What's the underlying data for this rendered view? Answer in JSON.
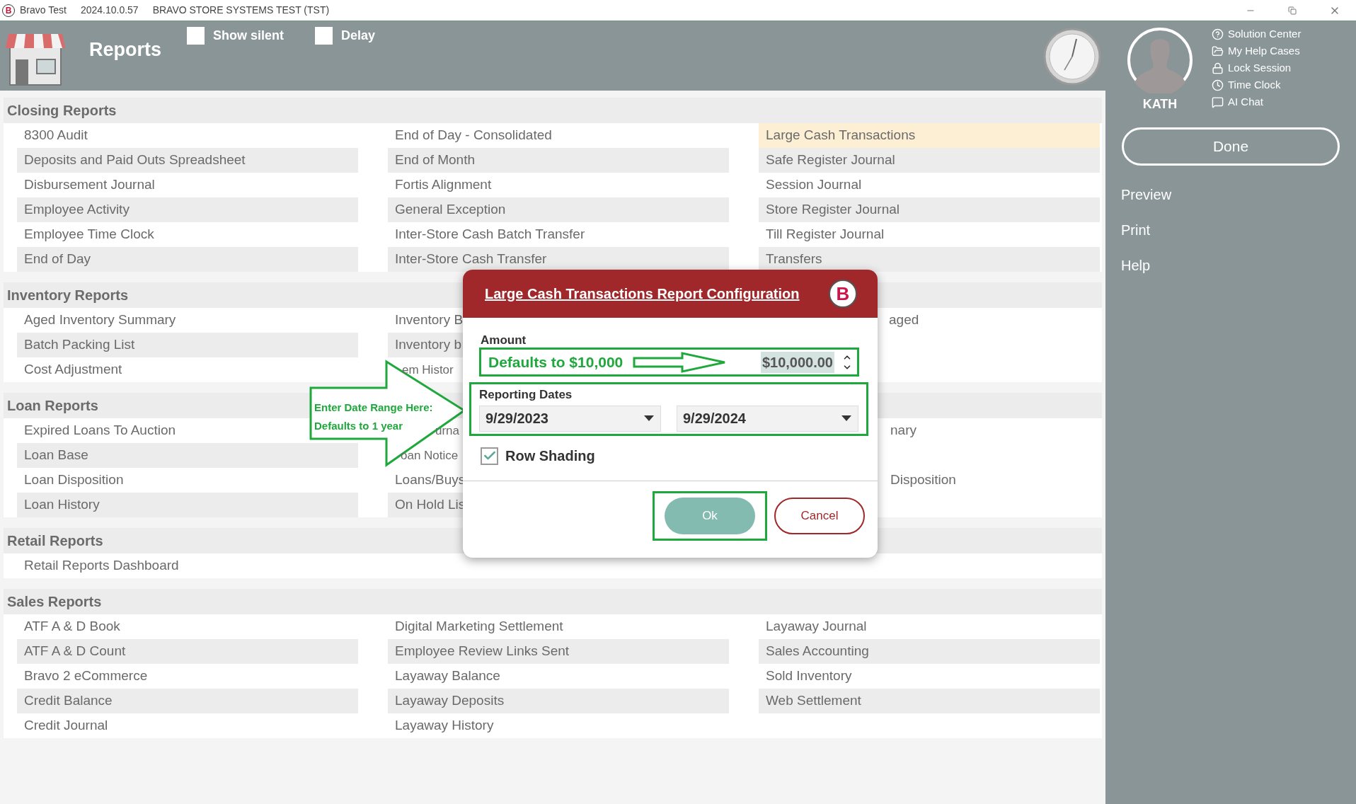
{
  "window": {
    "logo": "B",
    "title": "Bravo Test",
    "version": "2024.10.0.57",
    "environment": "BRAVO STORE SYSTEMS TEST (TST)"
  },
  "header": {
    "title": "Reports",
    "options": [
      {
        "label": "Show silent",
        "checked": false
      },
      {
        "label": "Delay",
        "checked": false
      }
    ]
  },
  "sections": [
    {
      "title": "Closing Reports",
      "rows": [
        [
          {
            "label": "8300 Audit",
            "selected": false
          },
          {
            "label": "End of Day - Consolidated",
            "selected": false
          },
          {
            "label": "Large Cash Transactions",
            "selected": true
          }
        ],
        [
          {
            "label": "Deposits and Paid Outs Spreadsheet",
            "selected": false
          },
          {
            "label": "End of Month",
            "selected": false
          },
          {
            "label": "Safe Register Journal",
            "selected": false
          }
        ],
        [
          {
            "label": "Disbursement Journal",
            "selected": false
          },
          {
            "label": "Fortis Alignment",
            "selected": false
          },
          {
            "label": "Session Journal",
            "selected": false
          }
        ],
        [
          {
            "label": "Employee Activity",
            "selected": false
          },
          {
            "label": "General Exception",
            "selected": false
          },
          {
            "label": "Store Register Journal",
            "selected": false
          }
        ],
        [
          {
            "label": "Employee Time Clock",
            "selected": false
          },
          {
            "label": "Inter-Store Cash Batch Transfer",
            "selected": false
          },
          {
            "label": "Till Register Journal",
            "selected": false
          }
        ],
        [
          {
            "label": "End of Day",
            "selected": false
          },
          {
            "label": "Inter-Store Cash Transfer",
            "selected": false
          },
          {
            "label": "Transfers",
            "selected": false
          }
        ]
      ]
    },
    {
      "title": "Inventory Reports",
      "rows": [
        [
          {
            "label": "Aged Inventory Summary",
            "selected": false
          },
          {
            "label": "Inventory B",
            "selected": false
          },
          {
            "label": "aged",
            "selected": false
          }
        ],
        [
          {
            "label": "Batch Packing List",
            "selected": false
          },
          {
            "label": "Inventory b",
            "selected": false
          },
          null
        ],
        [
          {
            "label": "Cost Adjustment",
            "selected": false
          },
          {
            "label": "em Histor",
            "selected": false
          },
          null
        ]
      ]
    },
    {
      "title": "Loan Reports",
      "rows": [
        [
          {
            "label": "Expired Loans To Auction",
            "selected": false
          },
          {
            "label": "urna",
            "selected": false
          },
          {
            "label": "nary",
            "selected": false
          }
        ],
        [
          {
            "label": "Loan Base",
            "selected": false
          },
          {
            "label": "oan Notice",
            "selected": false
          },
          null
        ],
        [
          {
            "label": "Loan Disposition",
            "selected": false
          },
          {
            "label": "Loans/Buys",
            "selected": false
          },
          {
            "label": "Disposition",
            "selected": false
          }
        ],
        [
          {
            "label": "Loan History",
            "selected": false
          },
          {
            "label": "On Hold Lis",
            "selected": false
          },
          null
        ]
      ]
    },
    {
      "title": "Retail Reports",
      "rows": [
        [
          {
            "label": "Retail Reports Dashboard",
            "selected": false
          },
          null,
          null
        ]
      ]
    },
    {
      "title": "Sales Reports",
      "rows": [
        [
          {
            "label": "ATF A & D Book",
            "selected": false
          },
          {
            "label": "Digital Marketing Settlement",
            "selected": false
          },
          {
            "label": "Layaway Journal",
            "selected": false
          }
        ],
        [
          {
            "label": "ATF A & D Count",
            "selected": false
          },
          {
            "label": "Employee Review Links Sent",
            "selected": false
          },
          {
            "label": "Sales Accounting",
            "selected": false
          }
        ],
        [
          {
            "label": "Bravo 2 eCommerce",
            "selected": false
          },
          {
            "label": "Layaway Balance",
            "selected": false
          },
          {
            "label": "Sold Inventory",
            "selected": false
          }
        ],
        [
          {
            "label": "Credit Balance",
            "selected": false
          },
          {
            "label": "Layaway Deposits",
            "selected": false
          },
          {
            "label": "Web Settlement",
            "selected": false
          }
        ],
        [
          {
            "label": "Credit Journal",
            "selected": false
          },
          {
            "label": "Layaway History",
            "selected": false
          },
          null
        ]
      ]
    }
  ],
  "user": {
    "name": "KATH"
  },
  "user_menu": [
    {
      "kind": "help",
      "label": "Solution Center"
    },
    {
      "kind": "folder",
      "label": "My Help Cases"
    },
    {
      "kind": "lock",
      "label": "Lock Session"
    },
    {
      "kind": "clock",
      "label": "Time Clock"
    },
    {
      "kind": "chat",
      "label": "AI Chat"
    }
  ],
  "actions": {
    "done": "Done",
    "links": [
      "Preview",
      "Print",
      "Help"
    ]
  },
  "dialog": {
    "title": "Large Cash Transactions Report Configuration",
    "logo": "B",
    "amount": {
      "label": "Amount",
      "value": "$10,000.00"
    },
    "dates": {
      "label": "Reporting Dates",
      "from": "9/29/2023",
      "to": "9/29/2024"
    },
    "row_shading": {
      "label": "Row Shading",
      "checked": true
    },
    "buttons": [
      {
        "kind": "primary",
        "label": "Ok"
      },
      {
        "kind": "secondary",
        "label": "Cancel"
      }
    ]
  },
  "annotations": {
    "amount_note": "Defaults to $10,000",
    "date_note": [
      "Enter Date Range Here:",
      "Defaults to 1 year"
    ]
  }
}
